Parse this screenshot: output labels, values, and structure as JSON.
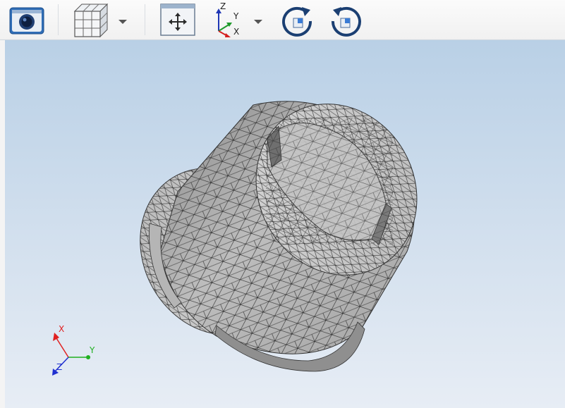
{
  "toolbar": {
    "buttons": [
      {
        "name": "screenshot-button",
        "icon": "camera-icon"
      },
      {
        "name": "display-mode-button",
        "icon": "wireframe-cube-icon"
      },
      {
        "name": "fit-all-button",
        "icon": "fit-all-icon"
      },
      {
        "name": "view-orientation-button",
        "icon": "axes-icon"
      },
      {
        "name": "rotate-cw-button",
        "icon": "rotate-clockwise-icon"
      },
      {
        "name": "rotate-ccw-button",
        "icon": "rotate-counterclockwise-icon"
      }
    ],
    "orientation_icon_labels": {
      "z": "Z",
      "y": "Y",
      "x": "X"
    }
  },
  "viewport": {
    "background_top": "#b9d0e6",
    "background_bottom": "#e7edf5",
    "mesh_color": "#c8c8c8",
    "triad": {
      "x_label": "X",
      "y_label": "Y",
      "z_label": "Z",
      "x_color": "#e02020",
      "y_color": "#20b020",
      "z_color": "#2030d0"
    }
  }
}
